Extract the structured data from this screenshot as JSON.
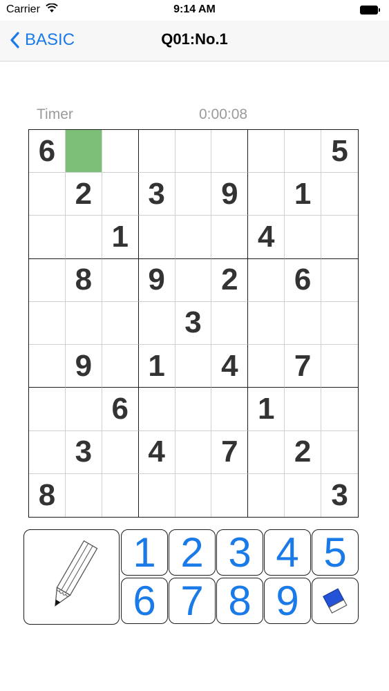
{
  "status_bar": {
    "carrier": "Carrier",
    "time": "9:14 AM"
  },
  "nav": {
    "back_label": "BASIC",
    "title": "Q01:No.1"
  },
  "timer": {
    "label": "Timer",
    "value": "0:00:08"
  },
  "board": {
    "selected_cell": [
      0,
      1
    ],
    "selected_color": "#7bbf78",
    "rows": [
      [
        "6",
        "",
        "",
        "",
        "",
        "",
        "",
        "",
        "5"
      ],
      [
        "",
        "2",
        "",
        "3",
        "",
        "9",
        "",
        "1",
        ""
      ],
      [
        "",
        "",
        "1",
        "",
        "",
        "",
        "4",
        "",
        ""
      ],
      [
        "",
        "8",
        "",
        "9",
        "",
        "2",
        "",
        "6",
        ""
      ],
      [
        "",
        "",
        "",
        "",
        "3",
        "",
        "",
        "",
        ""
      ],
      [
        "",
        "9",
        "",
        "1",
        "",
        "4",
        "",
        "7",
        ""
      ],
      [
        "",
        "",
        "6",
        "",
        "",
        "",
        "1",
        "",
        ""
      ],
      [
        "",
        "3",
        "",
        "4",
        "",
        "7",
        "",
        "2",
        ""
      ],
      [
        "8",
        "",
        "",
        "",
        "",
        "",
        "",
        "",
        "3"
      ]
    ]
  },
  "keypad": {
    "accent_color": "#1a7ae8",
    "pencil_icon": "pencil-icon",
    "eraser_icon": "eraser-icon",
    "numbers": [
      "1",
      "2",
      "3",
      "4",
      "5",
      "6",
      "7",
      "8",
      "9"
    ]
  }
}
